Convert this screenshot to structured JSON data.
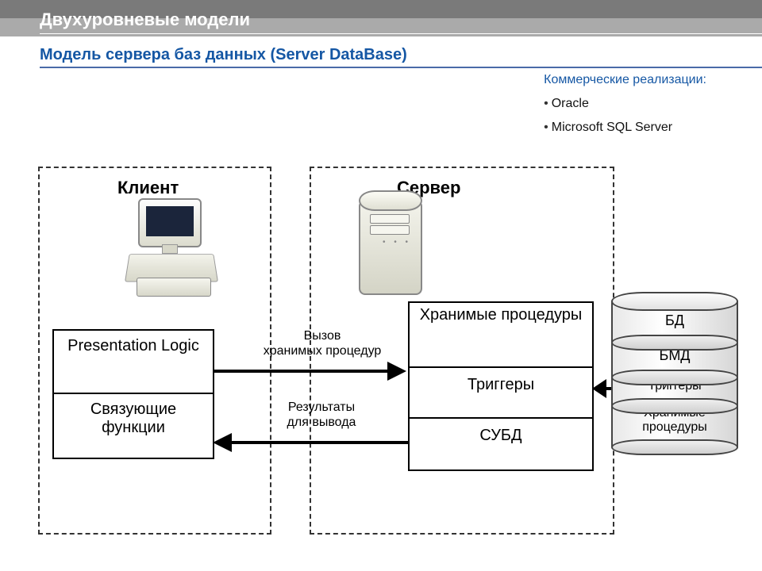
{
  "header": {
    "title": "Двухуровневые модели",
    "subtitle": "Модель сервера баз данных (Server DataBase)"
  },
  "implementations": {
    "title": "Коммерческие реализации:",
    "items": [
      "Oracle",
      "Microsoft  SQL Server"
    ]
  },
  "diagram": {
    "client_area_label": "Клиент",
    "server_area_label": "Сервер",
    "client_box": {
      "row1": "Presentation Logic",
      "row2": "Связующие функции"
    },
    "server_box": {
      "row1": "Хранимые процедуры",
      "row2": "Триггеры",
      "row3": "СУБД"
    },
    "db_stack": {
      "c1": "БД",
      "c2": "БМД",
      "c3": "Триггеры",
      "c4": "Хранимые процедуры"
    },
    "arrows": {
      "call_label_l1": "Вызов",
      "call_label_l2": "хранимых процедур",
      "result_label_l1": "Результаты",
      "result_label_l2": "для вывода"
    }
  }
}
